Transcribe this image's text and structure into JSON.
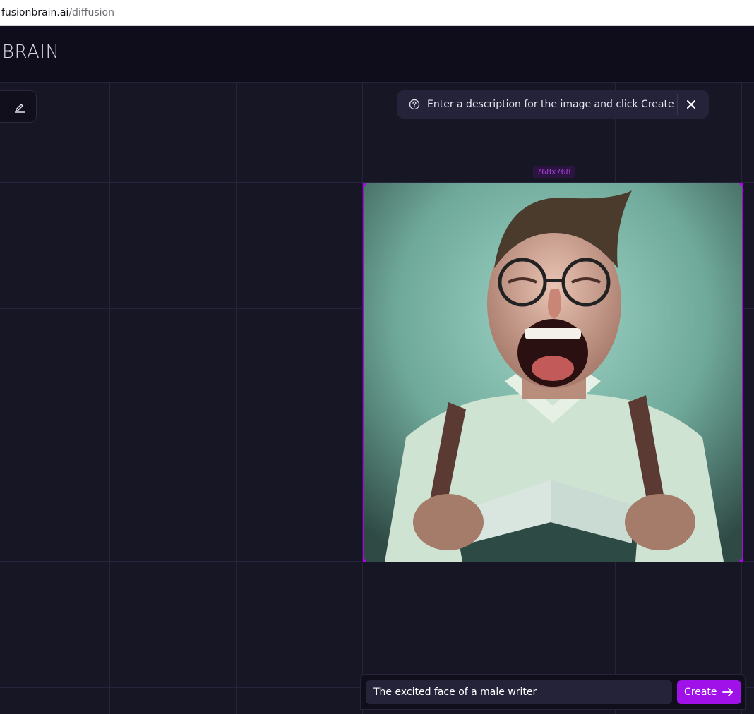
{
  "browser": {
    "url_host": "fusionbrain.ai",
    "url_path": "/diffusion"
  },
  "header": {
    "logo_text": "BRAIN"
  },
  "toolbar": {
    "tool_icon": "eraser-icon"
  },
  "hint": {
    "icon": "question-circle-icon",
    "text": "Enter a description for the image and click Create",
    "close_icon": "close-icon"
  },
  "image": {
    "size_label": "768x768",
    "description": "Generated portrait of an excited laughing man with glasses holding a book"
  },
  "prompt_bar": {
    "prompt_value": "The excited face of a male writer",
    "create_label": "Create",
    "create_icon": "arrow-right-icon"
  },
  "colors": {
    "accent": "#a010e8",
    "frame": "#b000f0",
    "background": "#171624"
  }
}
